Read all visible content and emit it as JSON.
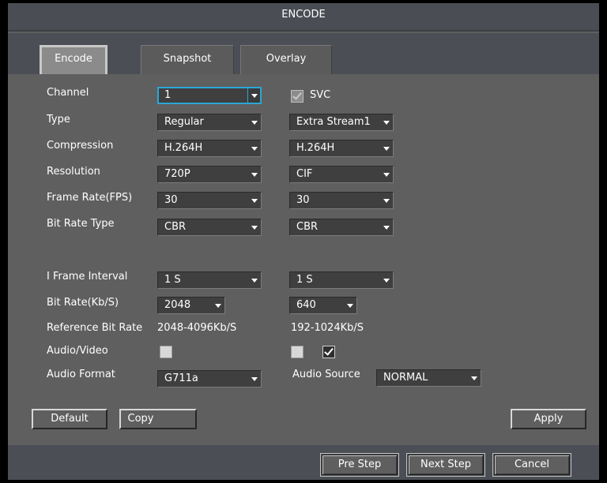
{
  "window": {
    "title": "ENCODE"
  },
  "tabs": [
    "Encode",
    "Snapshot",
    "Overlay"
  ],
  "labels": {
    "channel": "Channel",
    "type": "Type",
    "compression": "Compression",
    "resolution": "Resolution",
    "frame_rate": "Frame Rate(FPS)",
    "bit_rate_type": "Bit Rate Type",
    "i_frame_interval": "I Frame Interval",
    "bit_rate": "Bit Rate(Kb/S)",
    "reference_bit_rate": "Reference Bit Rate",
    "audio_video": "Audio/Video",
    "audio_format": "Audio Format",
    "audio_source": "Audio Source",
    "svc": "SVC"
  },
  "main": {
    "channel": "1",
    "type": "Regular",
    "compression": "H.264H",
    "resolution": "720P",
    "frame_rate": "30",
    "bit_rate_type": "CBR",
    "i_frame_interval": "1 S",
    "bit_rate": "2048",
    "reference_bit_rate": "2048-4096Kb/S",
    "audio_format": "G711a",
    "audio_video_checked": false
  },
  "extra": {
    "type": "Extra Stream1",
    "compression": "H.264H",
    "resolution": "CIF",
    "frame_rate": "30",
    "bit_rate_type": "CBR",
    "i_frame_interval": "1 S",
    "bit_rate": "640",
    "reference_bit_rate": "192-1024Kb/S",
    "audio_source": "NORMAL",
    "audio_video_checked": false,
    "extra_checkbox_checked": true
  },
  "svc_checked": true,
  "buttons": {
    "default": "Default",
    "copy": "Copy",
    "apply": "Apply",
    "pre_step": "Pre Step",
    "next_step": "Next Step",
    "cancel": "Cancel"
  }
}
